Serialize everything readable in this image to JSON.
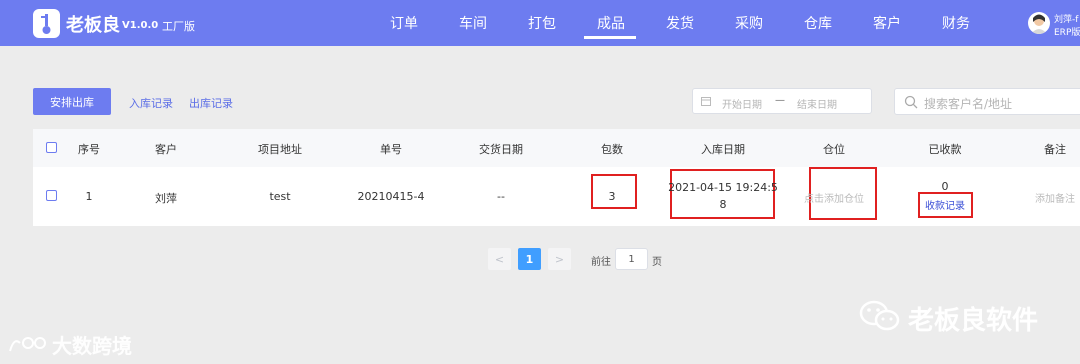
{
  "header": {
    "brand": "老板良",
    "version": "V1.0.0",
    "edition": "工厂版",
    "nav": [
      "订单",
      "车间",
      "打包",
      "成品",
      "发货",
      "采购",
      "仓库",
      "客户",
      "财务"
    ],
    "active_nav": "成品",
    "user_name": "刘萍-f",
    "user_sub": "ERP版"
  },
  "toolbar": {
    "primary_button": "安排出库",
    "links": [
      "入库记录",
      "出库记录"
    ],
    "date_start_placeholder": "开始日期",
    "date_separator": "—",
    "date_end_placeholder": "结束日期",
    "search_placeholder": "搜索客户名/地址"
  },
  "table": {
    "headers": [
      "序号",
      "客户",
      "项目地址",
      "单号",
      "交货日期",
      "包数",
      "入库日期",
      "仓位",
      "已收款",
      "备注"
    ],
    "rows": [
      {
        "index": "1",
        "customer": "刘萍",
        "address": "test",
        "order_no": "20210415-4",
        "delivery_date": "--",
        "packages": "3",
        "stock_date_line1": "2021-04-15 19:24:5",
        "stock_date_line2": "8",
        "location_action": "点击添加仓位",
        "received": "0",
        "receipt_link": "收款记录",
        "remark_action": "添加备注"
      }
    ]
  },
  "pagination": {
    "prev": "<",
    "current_page": "1",
    "next": ">",
    "goto_label": "前往",
    "goto_value": "1",
    "page_unit": "页"
  },
  "watermarks": {
    "left": "大数跨境",
    "right": "老板良软件"
  },
  "colors": {
    "header_bg": "#6d7cf0",
    "primary": "#6d7cf0",
    "page_active": "#409eff",
    "highlight_box": "#e02020"
  }
}
